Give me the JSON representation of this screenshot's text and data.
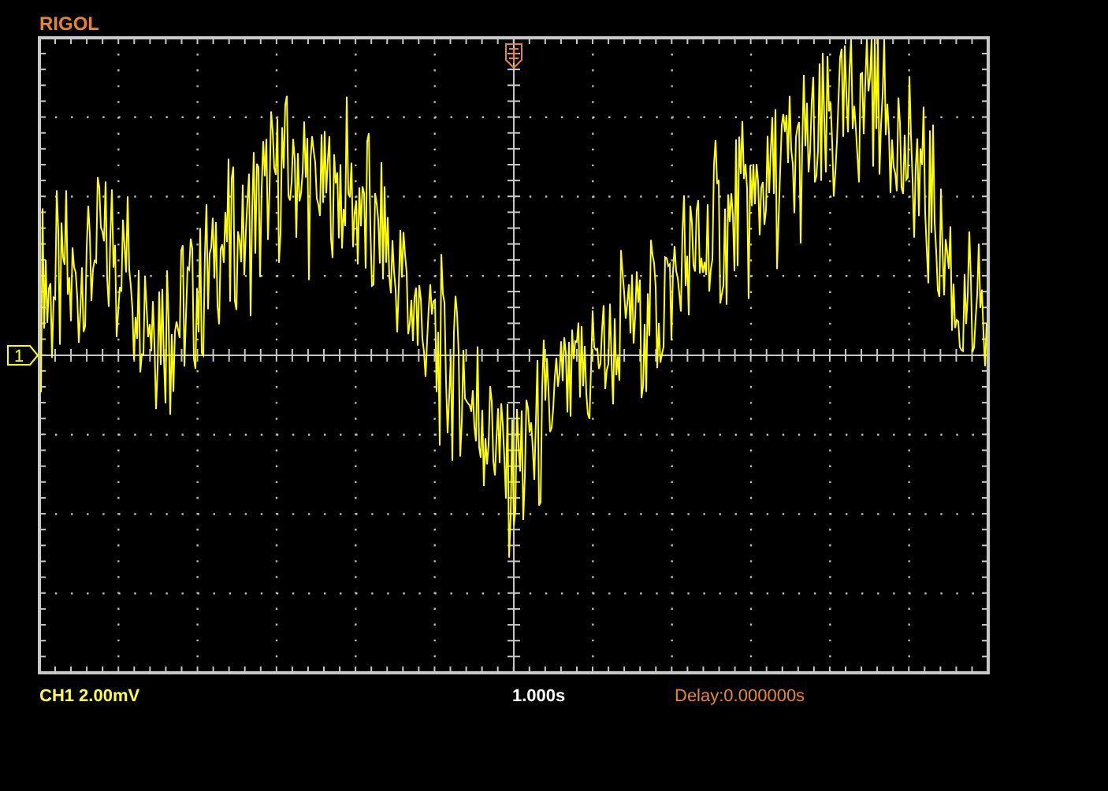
{
  "brand": "RIGOL",
  "channel_marker": {
    "label": "1"
  },
  "footer": {
    "channel_scale": "CH1 2.00mV",
    "timebase": "1.000s",
    "delay": "Delay:0.000000s"
  }
}
